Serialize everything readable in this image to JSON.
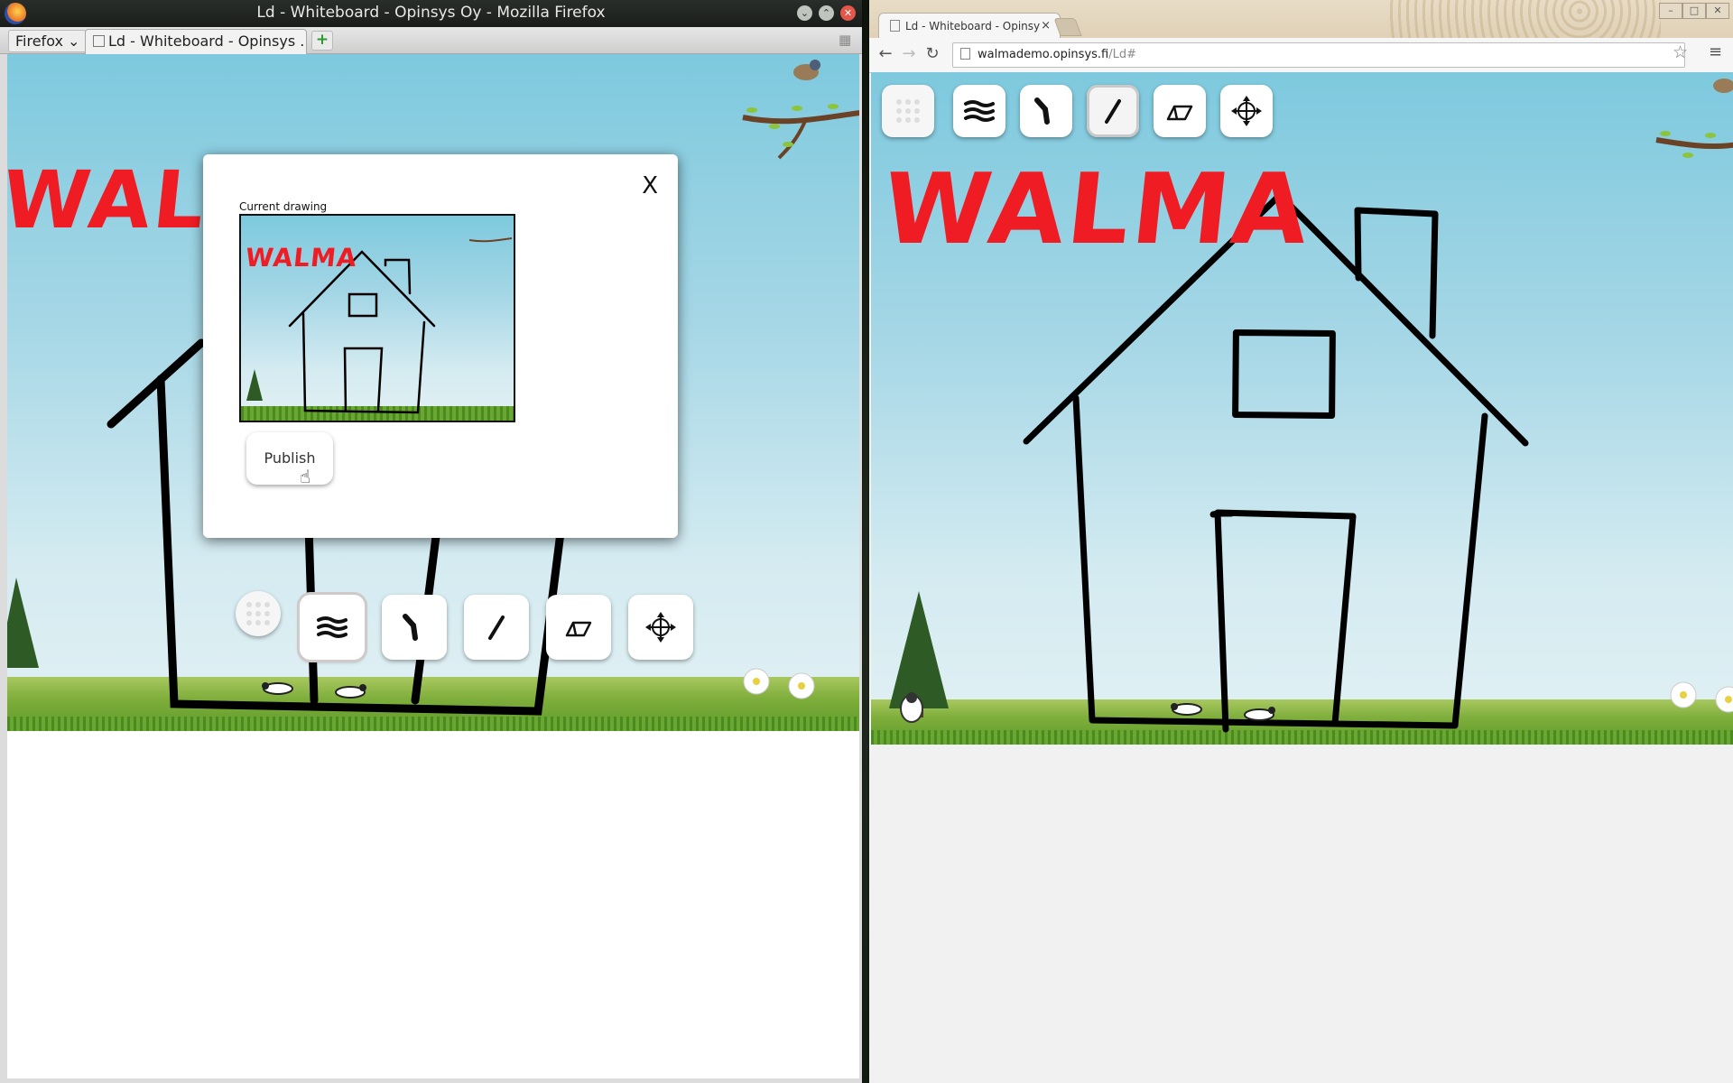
{
  "firefox": {
    "window_title": "Ld - Whiteboard - Opinsys Oy - Mozilla Firefox",
    "menu_button": "Firefox",
    "tab_title": "Ld - Whiteboard - Opinsys ...",
    "new_tab": "+"
  },
  "chrome": {
    "tab_title": "Ld - Whiteboard - Opinsy",
    "tab_close": "×",
    "url_host": "walmademo.opinsys.fi",
    "url_path": "/Ld#"
  },
  "whiteboard": {
    "drawn_text": "WALMA",
    "drawn_text_color": "#f01c24",
    "tools": [
      {
        "name": "palette",
        "icon": "dot-grid-icon"
      },
      {
        "name": "line-width",
        "icon": "wave-lines-icon"
      },
      {
        "name": "free-draw",
        "icon": "freehand-stroke-icon"
      },
      {
        "name": "line",
        "icon": "straight-line-icon"
      },
      {
        "name": "eraser",
        "icon": "eraser-icon"
      },
      {
        "name": "move",
        "icon": "move-arrows-icon"
      }
    ]
  },
  "dialog": {
    "caption": "Current drawing",
    "close_label": "X",
    "publish_label": "Publish",
    "thumbnail_text": "WALMA"
  }
}
